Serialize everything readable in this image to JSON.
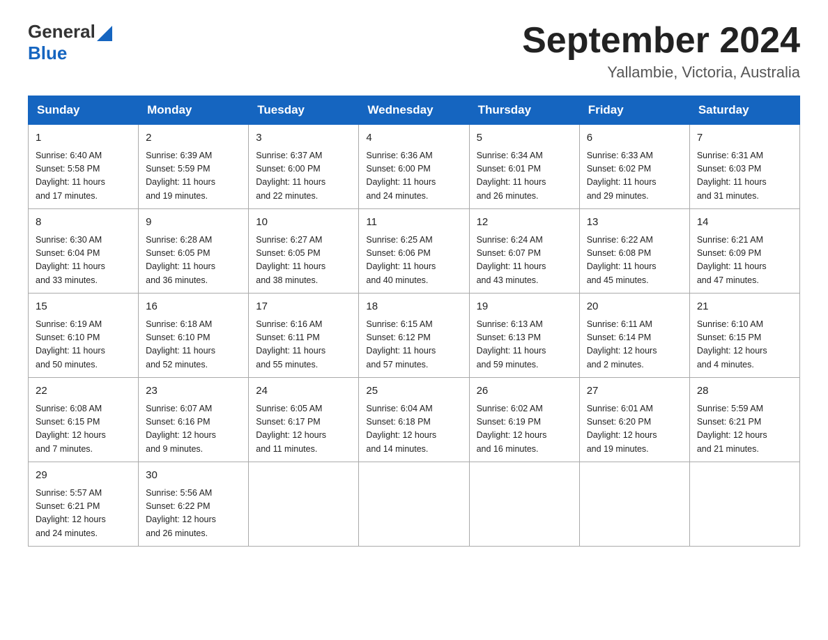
{
  "header": {
    "logo_general": "General",
    "logo_blue": "Blue",
    "title": "September 2024",
    "subtitle": "Yallambie, Victoria, Australia"
  },
  "days_of_week": [
    "Sunday",
    "Monday",
    "Tuesday",
    "Wednesday",
    "Thursday",
    "Friday",
    "Saturday"
  ],
  "weeks": [
    [
      {
        "day": "1",
        "sunrise": "6:40 AM",
        "sunset": "5:58 PM",
        "daylight": "11 hours and 17 minutes."
      },
      {
        "day": "2",
        "sunrise": "6:39 AM",
        "sunset": "5:59 PM",
        "daylight": "11 hours and 19 minutes."
      },
      {
        "day": "3",
        "sunrise": "6:37 AM",
        "sunset": "6:00 PM",
        "daylight": "11 hours and 22 minutes."
      },
      {
        "day": "4",
        "sunrise": "6:36 AM",
        "sunset": "6:00 PM",
        "daylight": "11 hours and 24 minutes."
      },
      {
        "day": "5",
        "sunrise": "6:34 AM",
        "sunset": "6:01 PM",
        "daylight": "11 hours and 26 minutes."
      },
      {
        "day": "6",
        "sunrise": "6:33 AM",
        "sunset": "6:02 PM",
        "daylight": "11 hours and 29 minutes."
      },
      {
        "day": "7",
        "sunrise": "6:31 AM",
        "sunset": "6:03 PM",
        "daylight": "11 hours and 31 minutes."
      }
    ],
    [
      {
        "day": "8",
        "sunrise": "6:30 AM",
        "sunset": "6:04 PM",
        "daylight": "11 hours and 33 minutes."
      },
      {
        "day": "9",
        "sunrise": "6:28 AM",
        "sunset": "6:05 PM",
        "daylight": "11 hours and 36 minutes."
      },
      {
        "day": "10",
        "sunrise": "6:27 AM",
        "sunset": "6:05 PM",
        "daylight": "11 hours and 38 minutes."
      },
      {
        "day": "11",
        "sunrise": "6:25 AM",
        "sunset": "6:06 PM",
        "daylight": "11 hours and 40 minutes."
      },
      {
        "day": "12",
        "sunrise": "6:24 AM",
        "sunset": "6:07 PM",
        "daylight": "11 hours and 43 minutes."
      },
      {
        "day": "13",
        "sunrise": "6:22 AM",
        "sunset": "6:08 PM",
        "daylight": "11 hours and 45 minutes."
      },
      {
        "day": "14",
        "sunrise": "6:21 AM",
        "sunset": "6:09 PM",
        "daylight": "11 hours and 47 minutes."
      }
    ],
    [
      {
        "day": "15",
        "sunrise": "6:19 AM",
        "sunset": "6:10 PM",
        "daylight": "11 hours and 50 minutes."
      },
      {
        "day": "16",
        "sunrise": "6:18 AM",
        "sunset": "6:10 PM",
        "daylight": "11 hours and 52 minutes."
      },
      {
        "day": "17",
        "sunrise": "6:16 AM",
        "sunset": "6:11 PM",
        "daylight": "11 hours and 55 minutes."
      },
      {
        "day": "18",
        "sunrise": "6:15 AM",
        "sunset": "6:12 PM",
        "daylight": "11 hours and 57 minutes."
      },
      {
        "day": "19",
        "sunrise": "6:13 AM",
        "sunset": "6:13 PM",
        "daylight": "11 hours and 59 minutes."
      },
      {
        "day": "20",
        "sunrise": "6:11 AM",
        "sunset": "6:14 PM",
        "daylight": "12 hours and 2 minutes."
      },
      {
        "day": "21",
        "sunrise": "6:10 AM",
        "sunset": "6:15 PM",
        "daylight": "12 hours and 4 minutes."
      }
    ],
    [
      {
        "day": "22",
        "sunrise": "6:08 AM",
        "sunset": "6:15 PM",
        "daylight": "12 hours and 7 minutes."
      },
      {
        "day": "23",
        "sunrise": "6:07 AM",
        "sunset": "6:16 PM",
        "daylight": "12 hours and 9 minutes."
      },
      {
        "day": "24",
        "sunrise": "6:05 AM",
        "sunset": "6:17 PM",
        "daylight": "12 hours and 11 minutes."
      },
      {
        "day": "25",
        "sunrise": "6:04 AM",
        "sunset": "6:18 PM",
        "daylight": "12 hours and 14 minutes."
      },
      {
        "day": "26",
        "sunrise": "6:02 AM",
        "sunset": "6:19 PM",
        "daylight": "12 hours and 16 minutes."
      },
      {
        "day": "27",
        "sunrise": "6:01 AM",
        "sunset": "6:20 PM",
        "daylight": "12 hours and 19 minutes."
      },
      {
        "day": "28",
        "sunrise": "5:59 AM",
        "sunset": "6:21 PM",
        "daylight": "12 hours and 21 minutes."
      }
    ],
    [
      {
        "day": "29",
        "sunrise": "5:57 AM",
        "sunset": "6:21 PM",
        "daylight": "12 hours and 24 minutes."
      },
      {
        "day": "30",
        "sunrise": "5:56 AM",
        "sunset": "6:22 PM",
        "daylight": "12 hours and 26 minutes."
      },
      null,
      null,
      null,
      null,
      null
    ]
  ],
  "labels": {
    "sunrise": "Sunrise:",
    "sunset": "Sunset:",
    "daylight": "Daylight:"
  }
}
